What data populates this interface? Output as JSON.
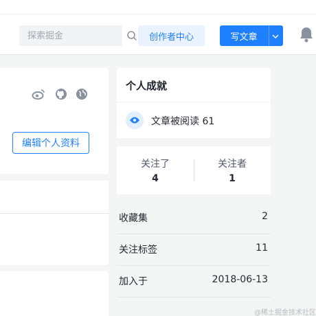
{
  "header": {
    "search_placeholder": "探索掘金",
    "creator_center_label": "创作者中心",
    "write_article_label": "写文章"
  },
  "profile": {
    "social_icons": [
      "weibo-icon",
      "github-icon",
      "website-globe-icon"
    ],
    "edit_profile_label": "编辑个人资料"
  },
  "achievements": {
    "title": "个人成就",
    "read_label": "文章被阅读",
    "read_count": "61"
  },
  "follow": {
    "following_label": "关注了",
    "following_count": "4",
    "followers_label": "关注者",
    "followers_count": "1"
  },
  "stats": [
    {
      "key": "收藏集",
      "value": "2"
    },
    {
      "key": "关注标签",
      "value": "11"
    },
    {
      "key": "加入于",
      "value": "2018-06-13"
    }
  ],
  "watermark": "@稀土掘金技术社区",
  "colors": {
    "brand_blue": "#1e80ff",
    "page_bg": "#f4f5f5",
    "light_blue": "#eaf2ff"
  }
}
